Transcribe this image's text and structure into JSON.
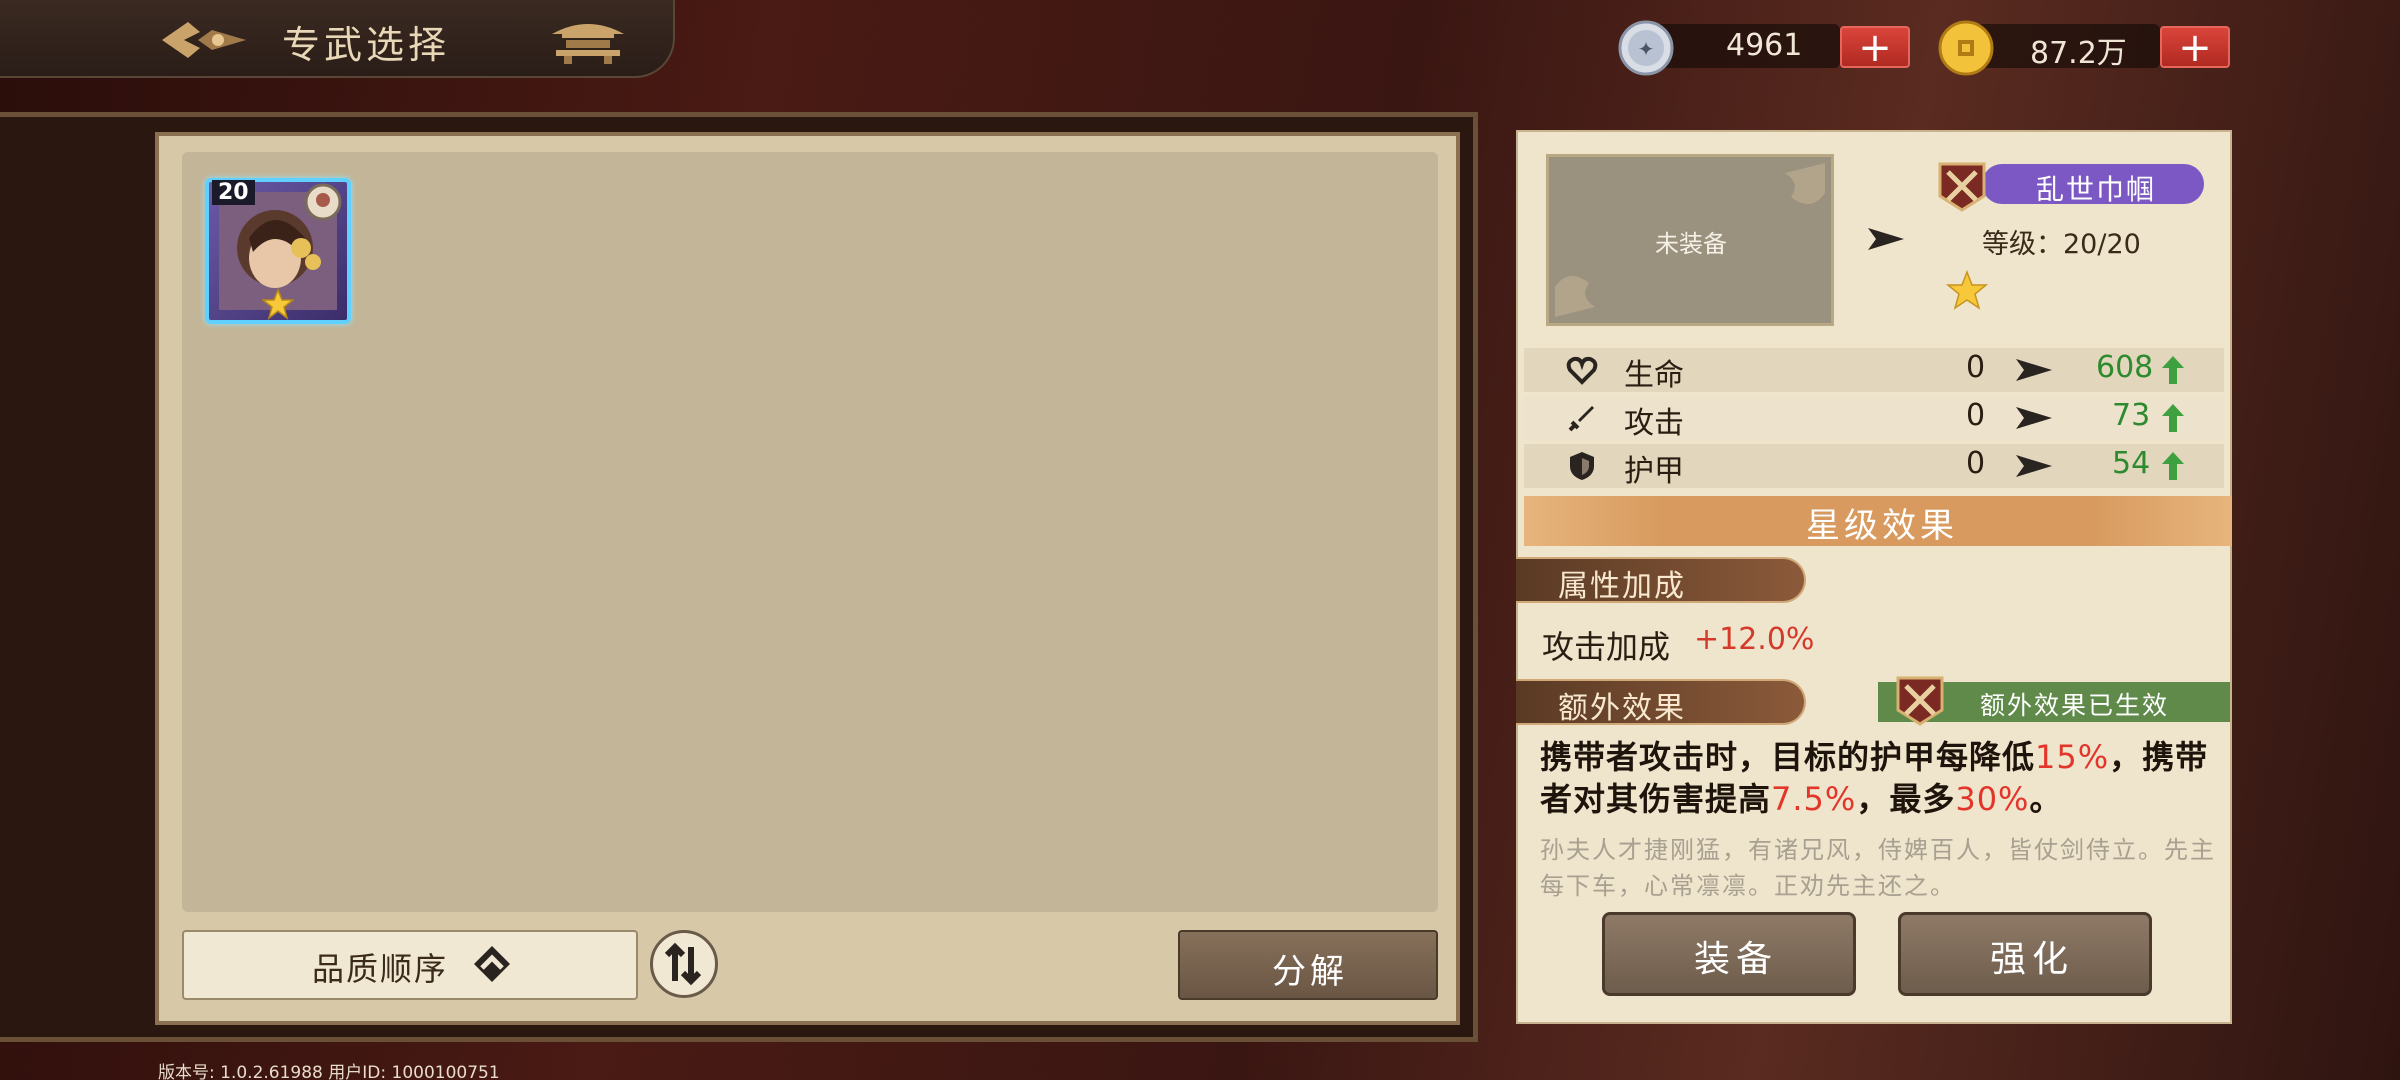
{
  "header": {
    "title": "专武选择",
    "currency_gem": "4961",
    "currency_gold": "87.2万"
  },
  "colors": {
    "accent_red": "#d43a2a",
    "accent_green": "#2e8a2e",
    "badge_purple": "#7b58c4",
    "active_green": "#5f8a4a",
    "item_border": "#5fd0ff"
  },
  "inventory": {
    "items": [
      {
        "level": "20",
        "rarity": "1-star"
      }
    ],
    "sort_label": "品质顺序",
    "decompose_label": "分解"
  },
  "detail": {
    "preview_text": "未装备",
    "weapon_name": "乱世巾帼",
    "level_line": "等级：20/20",
    "stats": [
      {
        "name": "生命",
        "icon": "heart-icon",
        "old": "0",
        "new": "608"
      },
      {
        "name": "攻击",
        "icon": "sword-icon",
        "old": "0",
        "new": "73"
      },
      {
        "name": "护甲",
        "icon": "shield-icon",
        "old": "0",
        "new": "54"
      }
    ],
    "star_effect_title": "星级效果",
    "attr_bonus_tag": "属性加成",
    "attr_bonus_label": "攻击加成",
    "attr_bonus_value": "+12.0%",
    "extra_effect_tag": "额外效果",
    "extra_effect_active": "额外效果已生效",
    "effect_desc": {
      "part1": "携带者攻击时，目标的护甲每降低",
      "val1": "15%",
      "part2": "，携带者对其伤害提高",
      "val2": "7.5%",
      "part3": "，最多",
      "val3": "30%",
      "part4": "。"
    },
    "flavor_text": "孙夫人才捷刚猛，有诸兄风，侍婢百人，皆仗剑侍立。先主每下车，心常凛凛。正劝先主还之。",
    "equip_label": "装备",
    "enhance_label": "强化"
  },
  "footer": {
    "version": "版本号: 1.0.2.61988 用户ID: 1000100751"
  }
}
